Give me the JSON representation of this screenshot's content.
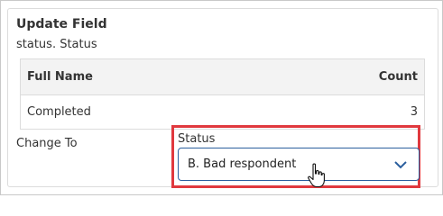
{
  "dialog": {
    "title": "Update Field",
    "subtitle": "status. Status"
  },
  "table": {
    "columns": [
      "Full Name",
      "Count"
    ],
    "rows": [
      {
        "name": "Completed",
        "count": "3"
      }
    ]
  },
  "change": {
    "label": "Change To",
    "status_label": "Status",
    "selected_value": "B. Bad respondent"
  },
  "colors": {
    "highlight": "#e0393e",
    "select_border": "#2b5f9e"
  },
  "icons": [
    "chevron-down-icon",
    "hand-cursor-icon"
  ]
}
